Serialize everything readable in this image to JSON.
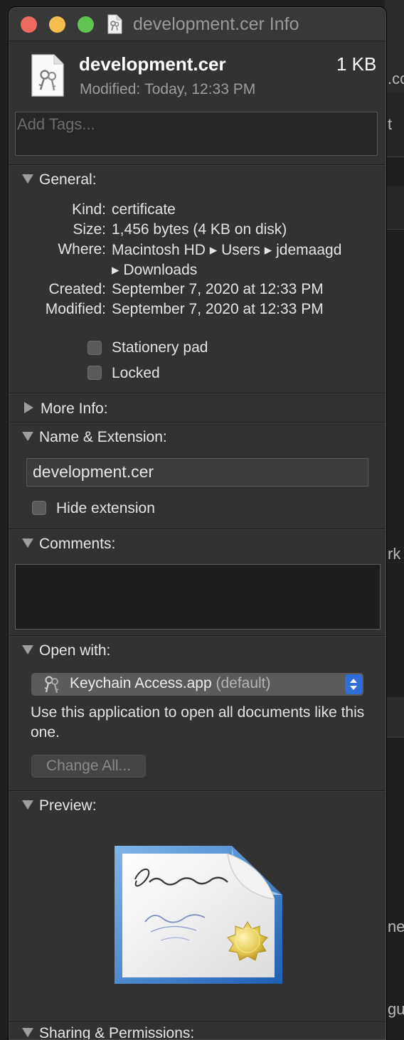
{
  "window": {
    "title": "development.cer Info"
  },
  "header": {
    "file_name": "development.cer",
    "file_size": "1 KB",
    "modified_label": "Modified:",
    "modified_value": "Today, 12:33 PM"
  },
  "tags": {
    "placeholder": "Add Tags..."
  },
  "general": {
    "heading": "General:",
    "kind_label": "Kind:",
    "kind_value": "certificate",
    "size_label": "Size:",
    "size_value": "1,456 bytes (4 KB on disk)",
    "where_label": "Where:",
    "where_value_line1": "Macintosh HD ▸ Users ▸ jdemaagd",
    "where_value_line2": "▸ Downloads",
    "created_label": "Created:",
    "created_value": "September 7, 2020 at 12:33 PM",
    "modified_label": "Modified:",
    "modified_value": "September 7, 2020 at 12:33 PM",
    "stationery_label": "Stationery pad",
    "locked_label": "Locked"
  },
  "more_info": {
    "heading": "More Info:"
  },
  "name_extension": {
    "heading": "Name & Extension:",
    "name_value": "development.cer",
    "hide_extension_label": "Hide extension"
  },
  "comments": {
    "heading": "Comments:"
  },
  "open_with": {
    "heading": "Open with:",
    "app_name": "Keychain Access.app",
    "app_default": "(default)",
    "description": "Use this application to open all documents like this one.",
    "change_all_label": "Change All..."
  },
  "preview": {
    "heading": "Preview:"
  },
  "sharing": {
    "heading": "Sharing & Permissions:"
  },
  "background": {
    "fragment_1": ".co",
    "fragment_2": "t",
    "fragment_3": "rk",
    "fragment_4": "ne",
    "fragment_5": "gu"
  },
  "colors": {
    "window_bg": "#323232",
    "accent": "#2f6ed8",
    "close": "#ed6a5e",
    "minimize": "#f5bf4f",
    "zoom": "#61c554"
  }
}
